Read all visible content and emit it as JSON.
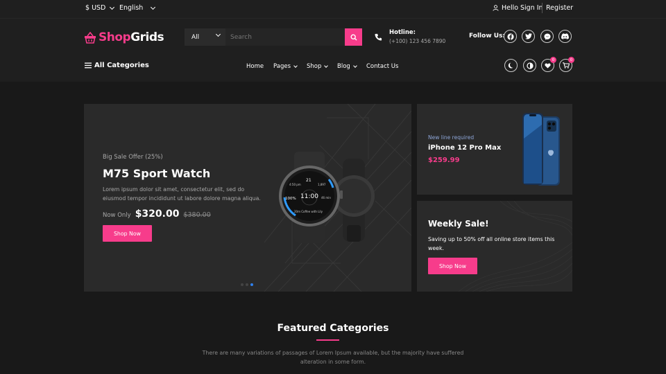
{
  "topbar": {
    "currency": "$ USD",
    "language": "English",
    "greeting": "Hello",
    "sign_in": "Sign In",
    "register": "Register"
  },
  "header": {
    "logo_shop": "Shop",
    "logo_grids": "Grids",
    "search": {
      "category": "All",
      "placeholder": "Search"
    },
    "hotline": {
      "label": "Hotline:",
      "number": "(+100) 123 456 7890"
    },
    "follow_us": "Follow Us:",
    "social_icons": [
      "facebook-icon",
      "twitter-icon",
      "messenger-icon",
      "discord-icon"
    ]
  },
  "nav": {
    "all_categories": "All Categories",
    "items": [
      {
        "label": "Home"
      },
      {
        "label": "Pages"
      },
      {
        "label": "Shop"
      },
      {
        "label": "Blog"
      },
      {
        "label": "Contact Us"
      }
    ],
    "wishlist_count": "0",
    "cart_count": "0"
  },
  "hero": {
    "small": "Big Sale Offer (25%)",
    "title": "M75 Sport Watch",
    "desc": "Lorem ipsum dolor sit amet, consectetur elit, sed do eiusmod tempor incididunt ut labore dolore magna aliqua.",
    "now_only": "Now Only",
    "price": "$320.00",
    "old_price": "$380.00",
    "button": "Shop Now",
    "watch_face": {
      "time": "11:00",
      "pct": "100%",
      "date": "21",
      "top_left": "4:50 pm",
      "top_right": "1,897",
      "right": "46 min",
      "bottom": "20m Coffee with Lily"
    },
    "slides": 3,
    "active_slide": 3
  },
  "promo1": {
    "subtitle": "New line required",
    "name": "iPhone 12 Pro Max",
    "price": "$259.99"
  },
  "promo2": {
    "title": "Weekly Sale!",
    "desc": "Saving up to 50% off all online store items this week.",
    "button": "Shop Now"
  },
  "featured": {
    "title": "Featured Categories",
    "desc": "There are many variations of passages of Lorem Ipsum available, but the majority have suffered alteration in some form."
  },
  "colors": {
    "accent": "#f73c8b",
    "background": "#191919",
    "panel": "#2a2a2a",
    "dot_active": "#2f80ed"
  }
}
